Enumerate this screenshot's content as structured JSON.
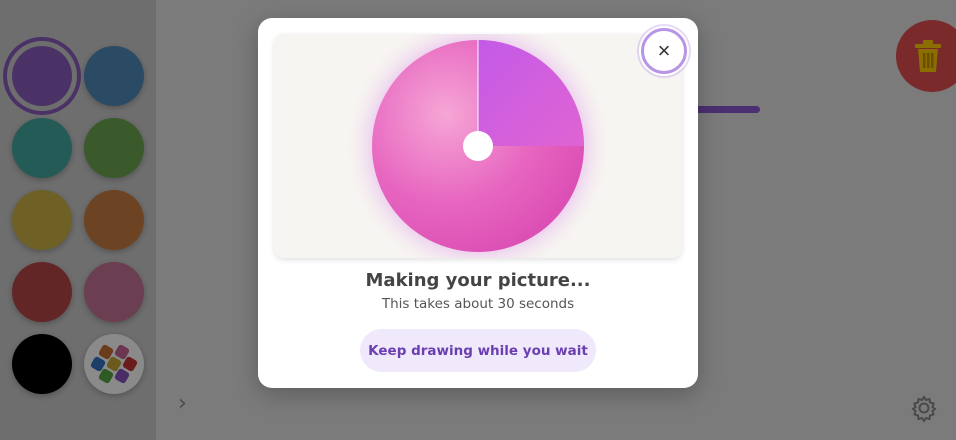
{
  "palette": {
    "swatches": [
      {
        "name": "purple",
        "color": "#4b3266",
        "selected": true
      },
      {
        "name": "blue",
        "color": "#2b4a63"
      },
      {
        "name": "teal",
        "color": "#245b56"
      },
      {
        "name": "green",
        "color": "#3a5a2c"
      },
      {
        "name": "yellow",
        "color": "#6f6126"
      },
      {
        "name": "orange",
        "color": "#6d4423"
      },
      {
        "name": "red",
        "color": "#632626"
      },
      {
        "name": "pink",
        "color": "#6b3e52"
      },
      {
        "name": "black",
        "color": "#000000"
      },
      {
        "name": "multicolor",
        "color": "#8a8a8a"
      }
    ]
  },
  "toolbar": {
    "trash_icon": "trash-icon",
    "settings_icon": "gear-icon",
    "expand_icon": "chevron-right-icon",
    "expand_glyph": "›"
  },
  "dialog": {
    "title": "Making your picture...",
    "subtitle": "This takes about 30 seconds",
    "keep_drawing_label": "Keep drawing while you wait",
    "close_glyph": "×",
    "progress": 0.25
  },
  "colors": {
    "accent": "#6b3fb0",
    "pie_remaining": "#e66ac0",
    "pie_done": "#c257e4"
  }
}
